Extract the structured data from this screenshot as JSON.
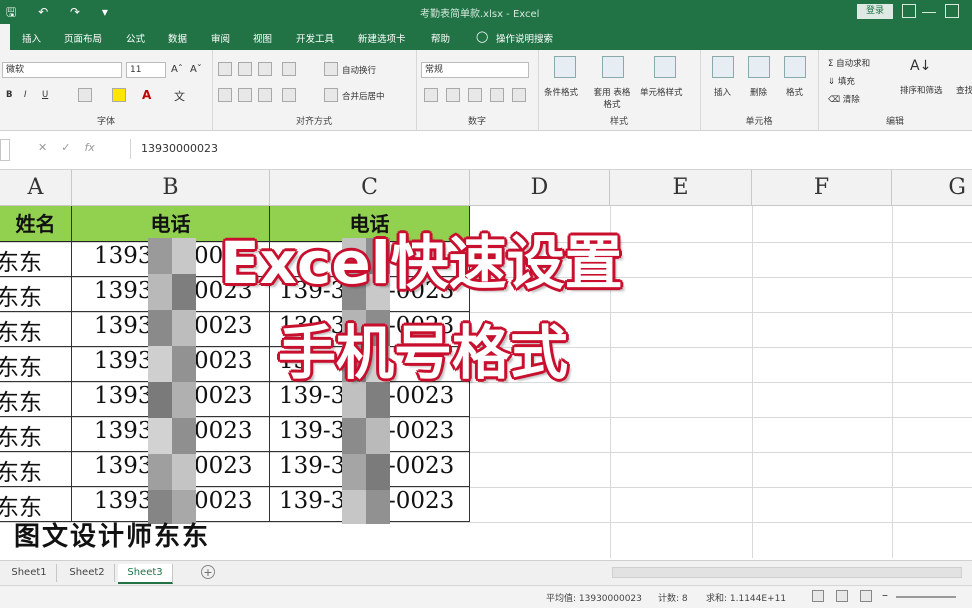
{
  "window": {
    "title": "考勤表简单款.xlsx - Excel",
    "login_label": "登录"
  },
  "tabs": [
    "插入",
    "页面布局",
    "公式",
    "数据",
    "审阅",
    "视图",
    "开发工具",
    "新建选项卡",
    "帮助",
    "操作说明搜索"
  ],
  "ribbon": {
    "font_name": "微软",
    "font_size": "11",
    "bold": "B",
    "italic": "I",
    "underline": "U",
    "wrap_text": "自动换行",
    "merge_center": "合并后居中",
    "number_format": "常规",
    "cond_format": "条件格式",
    "table_format": "套用 表格格式",
    "cell_style": "单元格样式",
    "insert": "插入",
    "delete": "删除",
    "format": "格式",
    "autosum": "自动求和",
    "fill": "填充",
    "clear": "清除",
    "sort_filter": "排序和筛选",
    "find_select": "查找和选择",
    "groups": {
      "font": "字体",
      "alignment": "对齐方式",
      "number": "数字",
      "styles": "样式",
      "cells": "单元格",
      "editing": "编辑"
    }
  },
  "formula_bar": {
    "fx": "fx",
    "value": "13930000023"
  },
  "columns": [
    "A",
    "B",
    "C",
    "D",
    "E",
    "F",
    "G"
  ],
  "sheet": {
    "header": [
      "姓名",
      "电话",
      "电话"
    ],
    "names": [
      "东东",
      "东东",
      "东东",
      "东东",
      "东东",
      "东东",
      "东东",
      "东东"
    ],
    "col_b_prefix": [
      "1393",
      "1393",
      "1393",
      "1393",
      "1393",
      "1393",
      "1393",
      "1393"
    ],
    "col_b_suffix": [
      "00",
      "0023",
      "0023",
      "0023",
      "0023",
      "0023",
      "0023",
      "0023"
    ],
    "col_c_prefix": [
      "",
      "139-3",
      "139-3",
      "13",
      "139-3",
      "139-3",
      "139-3",
      "139-3"
    ],
    "col_c_suffix": [
      "",
      "-0023",
      "-0023",
      "",
      "-0023",
      "-0023",
      "-0023",
      "-0023"
    ],
    "footer_caption": "图文设计师东东"
  },
  "overlay": {
    "line1": "Excel快速设置",
    "line2": "手机号格式"
  },
  "sheet_tabs": [
    "Sheet1",
    "Sheet2",
    "Sheet3"
  ],
  "active_sheet": "Sheet3",
  "status": {
    "average": "平均值: 13930000023",
    "count": "计数: 8",
    "sum": "求和: 1.1144E+11"
  },
  "colors": {
    "excel_green": "#217346",
    "header_fill": "#92d050",
    "overlay_stroke": "#c8102e"
  }
}
